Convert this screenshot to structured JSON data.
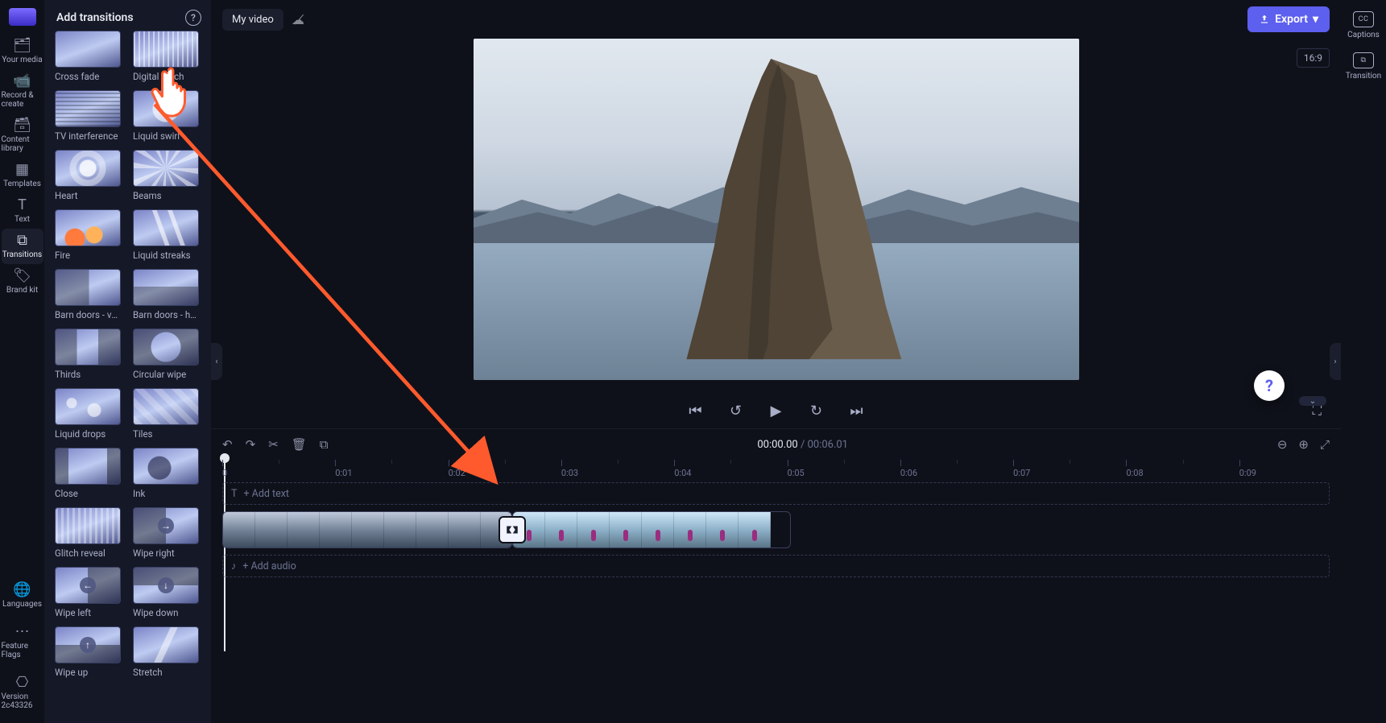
{
  "rail": {
    "items": [
      {
        "icon": "🗂",
        "label": "Your media"
      },
      {
        "icon": "📹",
        "label": "Record & create"
      },
      {
        "icon": "🗃",
        "label": "Content library"
      },
      {
        "icon": "▦",
        "label": "Templates"
      },
      {
        "icon": "T",
        "label": "Text"
      },
      {
        "icon": "⧉",
        "label": "Transitions",
        "active": true
      },
      {
        "icon": "🏷",
        "label": "Brand kit"
      }
    ],
    "bottom": [
      {
        "icon": "🌐",
        "label": "Languages"
      },
      {
        "icon": "⋯",
        "label": "Feature Flags"
      },
      {
        "icon": "⎔",
        "label": "Version 2c43326"
      }
    ]
  },
  "panel": {
    "title": "Add transitions",
    "transitions": [
      "Cross fade",
      "Digital glitch",
      "TV interference",
      "Liquid swirl",
      "Heart",
      "Beams",
      "Fire",
      "Liquid streaks",
      "Barn doors - ve…",
      "Barn doors - h…",
      "Thirds",
      "Circular wipe",
      "Liquid drops",
      "Tiles",
      "Close",
      "Ink",
      "Glitch reveal",
      "Wipe right",
      "Wipe left",
      "Wipe down",
      "Wipe up",
      "Stretch"
    ]
  },
  "right_rail": {
    "captions": "Captions",
    "cc": "CC",
    "transition": "Transition"
  },
  "topbar": {
    "project_name": "My video",
    "export": "Export",
    "aspect": "16:9"
  },
  "timeline": {
    "current": "00:00.00",
    "duration": "00:06.01",
    "ticks": [
      "0",
      "0:01",
      "0:02",
      "0:03",
      "0:04",
      "0:05",
      "0:06",
      "0:07",
      "0:08",
      "0:09"
    ],
    "add_text": "+ Add text",
    "add_audio": "+ Add audio"
  }
}
